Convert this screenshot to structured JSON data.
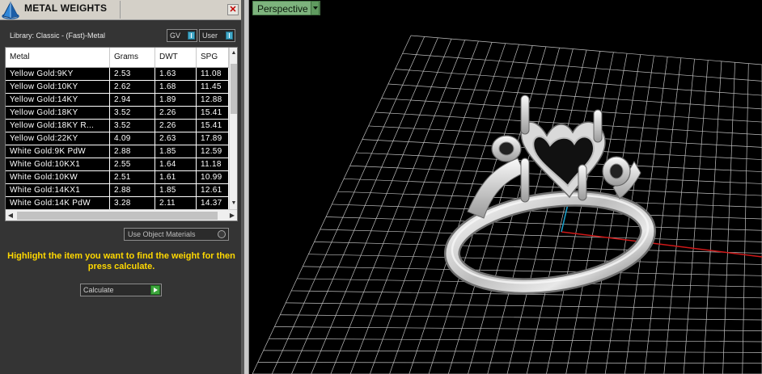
{
  "panel": {
    "title": "METAL WEIGHTS",
    "close_glyph": "✕",
    "library_label": "Library: Classic - (Fast)-Metal",
    "toggles": [
      {
        "label": "GV"
      },
      {
        "label": "User"
      }
    ],
    "table": {
      "columns": [
        "Metal",
        "Grams",
        "DWT",
        "SPG"
      ],
      "rows": [
        [
          "Yellow Gold:9KY",
          "2.53",
          "1.63",
          "11.08"
        ],
        [
          "Yellow Gold:10KY",
          "2.62",
          "1.68",
          "11.45"
        ],
        [
          "Yellow Gold:14KY",
          "2.94",
          "1.89",
          "12.88"
        ],
        [
          "Yellow Gold:18KY",
          "3.52",
          "2.26",
          "15.41"
        ],
        [
          "Yellow Gold:18KY R...",
          "3.52",
          "2.26",
          "15.41"
        ],
        [
          "Yellow Gold:22KY",
          "4.09",
          "2.63",
          "17.89"
        ],
        [
          "White Gold:9K PdW",
          "2.88",
          "1.85",
          "12.59"
        ],
        [
          "White Gold:10KX1",
          "2.55",
          "1.64",
          "11.18"
        ],
        [
          "White Gold:10KW",
          "2.51",
          "1.61",
          "10.99"
        ],
        [
          "White Gold:14KX1",
          "2.88",
          "1.85",
          "12.61"
        ],
        [
          "White Gold:14K PdW",
          "3.28",
          "2.11",
          "14.37"
        ]
      ]
    },
    "use_object_materials": "Use Object Materials",
    "instructions": "Highlight the item you want to find the weight for then press calculate.",
    "calculate_label": "Calculate"
  },
  "viewport": {
    "view_name": "Perspective"
  },
  "colors": {
    "highlight_text": "#ffd800",
    "viewport_tab": "#7db37d",
    "grid_line": "#bfbfbf",
    "x_axis": "#d01818",
    "y_axis": "#1a9ec8"
  },
  "icons": {
    "panel_logo": "pyramid-logo-icon",
    "close": "close-icon",
    "calculate_go": "play-arrow-icon",
    "view_dropdown": "chevron-down-icon"
  }
}
